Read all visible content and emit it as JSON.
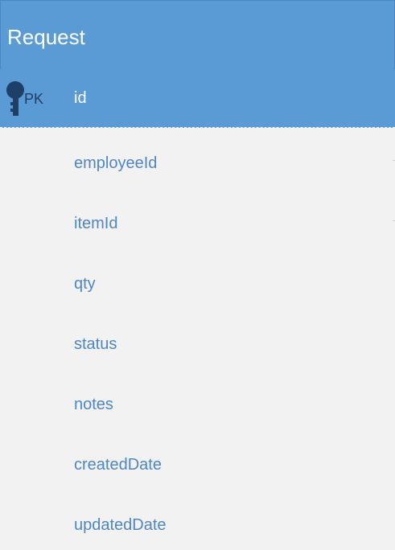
{
  "entity": {
    "title": "Request",
    "primary_key": {
      "marker": "PK",
      "name": "id"
    },
    "fields": [
      "employeeId",
      "itemId",
      "qty",
      "status",
      "notes",
      "createdDate",
      "updatedDate"
    ]
  },
  "colors": {
    "header": "#5b9bd5",
    "body": "#f2f2f2",
    "field_text": "#4f86c6",
    "header_text": "#ffffff",
    "pk_marker": "#1e3f66"
  }
}
